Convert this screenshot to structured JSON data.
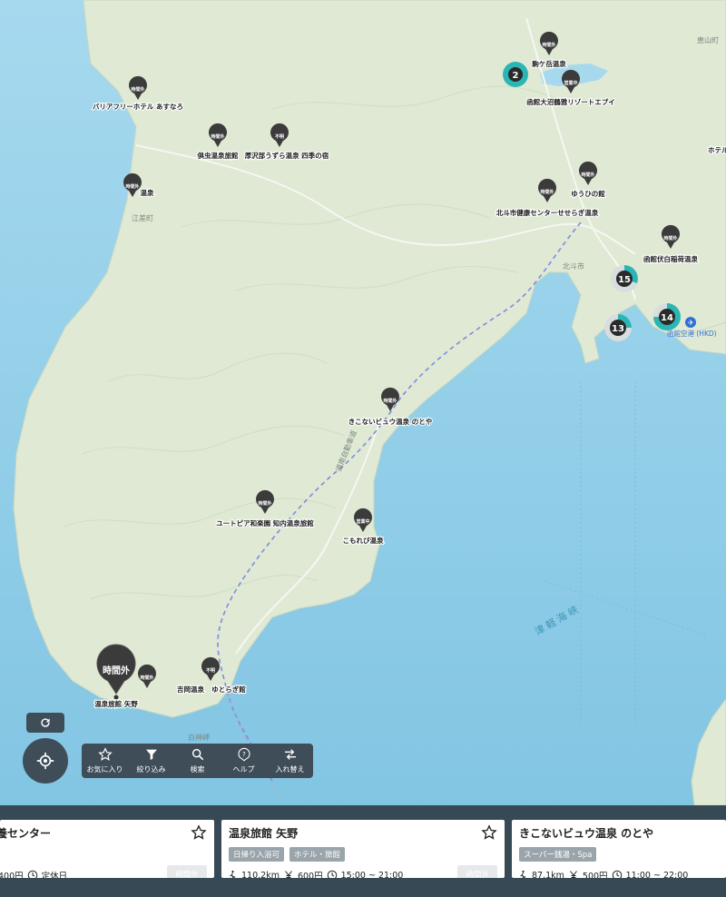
{
  "map": {
    "place_labels": [
      "江差町",
      "北斗市",
      "白神岬",
      "恵山町"
    ],
    "sea_label": "津軽海峡",
    "route_label": "道南自動車道",
    "airport": {
      "label": "函館空港 (HKD)",
      "icon": "airplane-icon"
    },
    "pins": [
      {
        "name": "バリアフリーホテル あすなろ",
        "tag": "時間外"
      },
      {
        "name": "俱虫温泉旅館",
        "tag": "時間外"
      },
      {
        "name": "厚沢部うずら温泉 四季の宿",
        "tag": "不明"
      },
      {
        "name": "温泉",
        "tag": "時間外"
      },
      {
        "name": "駒ケ岳温泉",
        "tag": "時間外"
      },
      {
        "name": "函館大沼鶴雅リゾートエプイ",
        "tag": "営業中"
      },
      {
        "name": "ゆうひの館",
        "tag": "時間外"
      },
      {
        "name": "北斗市健康センターせせらぎ温泉",
        "tag": "時間外"
      },
      {
        "name": "函館伏白稲荷温泉",
        "tag": "時間外"
      },
      {
        "name": "ホテル・",
        "tag": ""
      },
      {
        "name": "きこないビュウ温泉 のとや",
        "tag": "時間外"
      },
      {
        "name": "ユートピア和楽園 知内温泉旅館",
        "tag": "時間外"
      },
      {
        "name": "こもれび温泉",
        "tag": "営業中"
      },
      {
        "name": "吉岡温泉",
        "tag": "時間外"
      },
      {
        "name": "ゆとらぎ館",
        "tag": "不明"
      },
      {
        "name": "温泉旅館 矢野",
        "tag": "時間外",
        "selected": true
      }
    ],
    "clusters": [
      {
        "count": "2",
        "color": "#2cb5b5"
      },
      {
        "count": "15",
        "color": "#2cb5b5"
      },
      {
        "count": "13",
        "color": "#2cb5b5"
      },
      {
        "count": "14",
        "color": "#2cb5b5"
      }
    ]
  },
  "controls": {
    "refresh_icon": "refresh-icon",
    "locate_icon": "crosshair-icon"
  },
  "toolbar": {
    "items": [
      {
        "label": "お気に入り",
        "icon": "star-icon"
      },
      {
        "label": "絞り込み",
        "icon": "filter-icon"
      },
      {
        "label": "検索",
        "icon": "search-icon"
      },
      {
        "label": "ヘルプ",
        "icon": "help-icon"
      },
      {
        "label": "入れ替え",
        "icon": "swap-icon"
      }
    ]
  },
  "cards": [
    {
      "title": "養センター",
      "tags": [],
      "distance": "",
      "price": "400円",
      "hours": "定休日",
      "status": "時間外"
    },
    {
      "title": "温泉旅館 矢野",
      "tags": [
        "日帰り入浴可",
        "ホテル・旅館"
      ],
      "distance": "110.2km",
      "price": "600円",
      "hours": "15:00 ~ 21:00",
      "status": "時間外"
    },
    {
      "title": "きこないビュウ温泉 のとや",
      "tags": [
        "スーパー銭湯・Spa"
      ],
      "distance": "87.1km",
      "price": "500円",
      "hours": "11:00 ~ 22:00",
      "status": ""
    }
  ],
  "colors": {
    "panel": "#3f4d59",
    "strip": "#374955",
    "accent": "#2cb5b5",
    "sea": "#8fcde6",
    "land": "#dde9d3"
  }
}
